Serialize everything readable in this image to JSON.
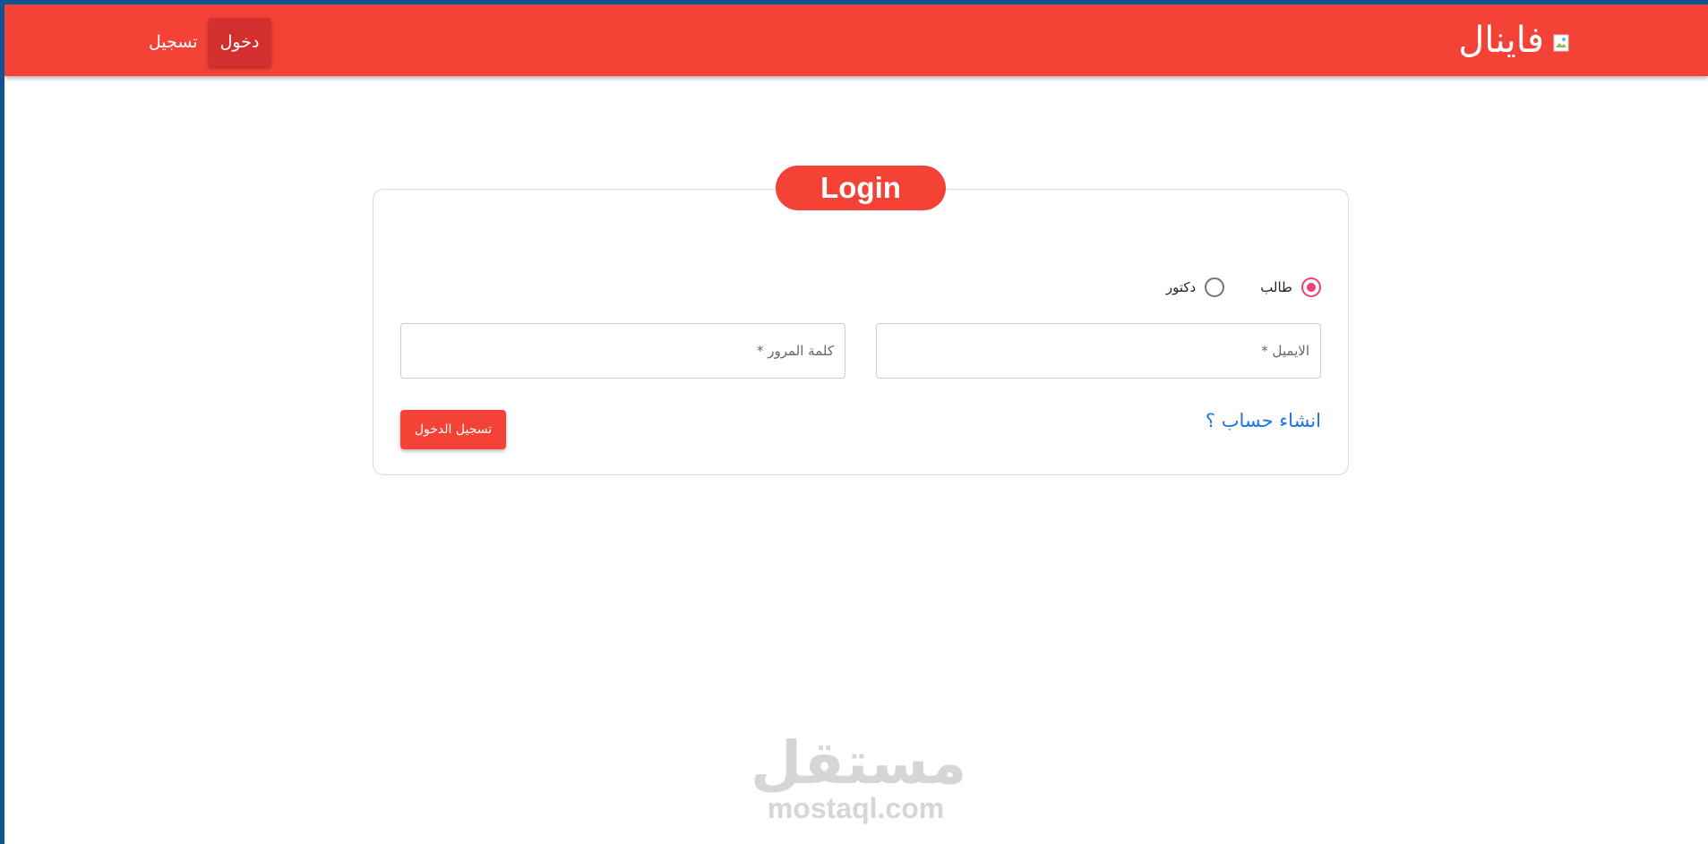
{
  "header": {
    "brand": "فاينال",
    "nav": {
      "login": "دخول",
      "register": "تسجيل"
    }
  },
  "card": {
    "title": "Login",
    "roles": [
      {
        "label": "طالب",
        "checked": true
      },
      {
        "label": "دكتور",
        "checked": false
      }
    ],
    "email": {
      "placeholder": "الايميل *",
      "value": ""
    },
    "password": {
      "placeholder": "كلمة المرور *",
      "value": ""
    },
    "create_account": "انشاء حساب ؟",
    "submit": "تسجيل الدخول"
  },
  "watermark": {
    "arabic": "مستقل",
    "latin": "mostaql.com"
  },
  "colors": {
    "primary": "#f44336",
    "primary_dark": "#d32f2f",
    "radio": "#ec407a",
    "link": "#1a73e8"
  }
}
